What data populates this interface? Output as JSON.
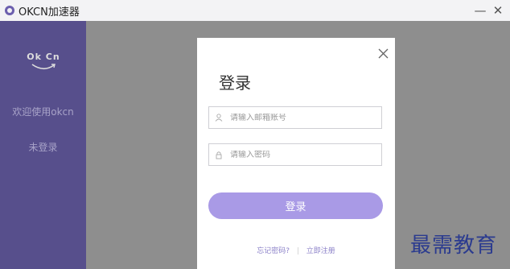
{
  "window": {
    "title": "OKCN加速器",
    "minimize_glyph": "—",
    "close_glyph": "✕"
  },
  "sidebar": {
    "brand_text": "Ok Cn",
    "welcome": "欢迎使用okcn",
    "login_status": "未登录"
  },
  "dialog": {
    "title": "登录",
    "email_placeholder": "请输入邮箱账号",
    "email_value": "",
    "password_placeholder": "请输入密码",
    "password_value": "",
    "submit_label": "登录",
    "forgot_label": "忘记密码?",
    "separator": "|",
    "register_label": "立即注册"
  },
  "watermark": "最需教育",
  "colors": {
    "sidebar": "#574f8c",
    "accent": "#a99ae6",
    "link": "#8c82c9"
  }
}
